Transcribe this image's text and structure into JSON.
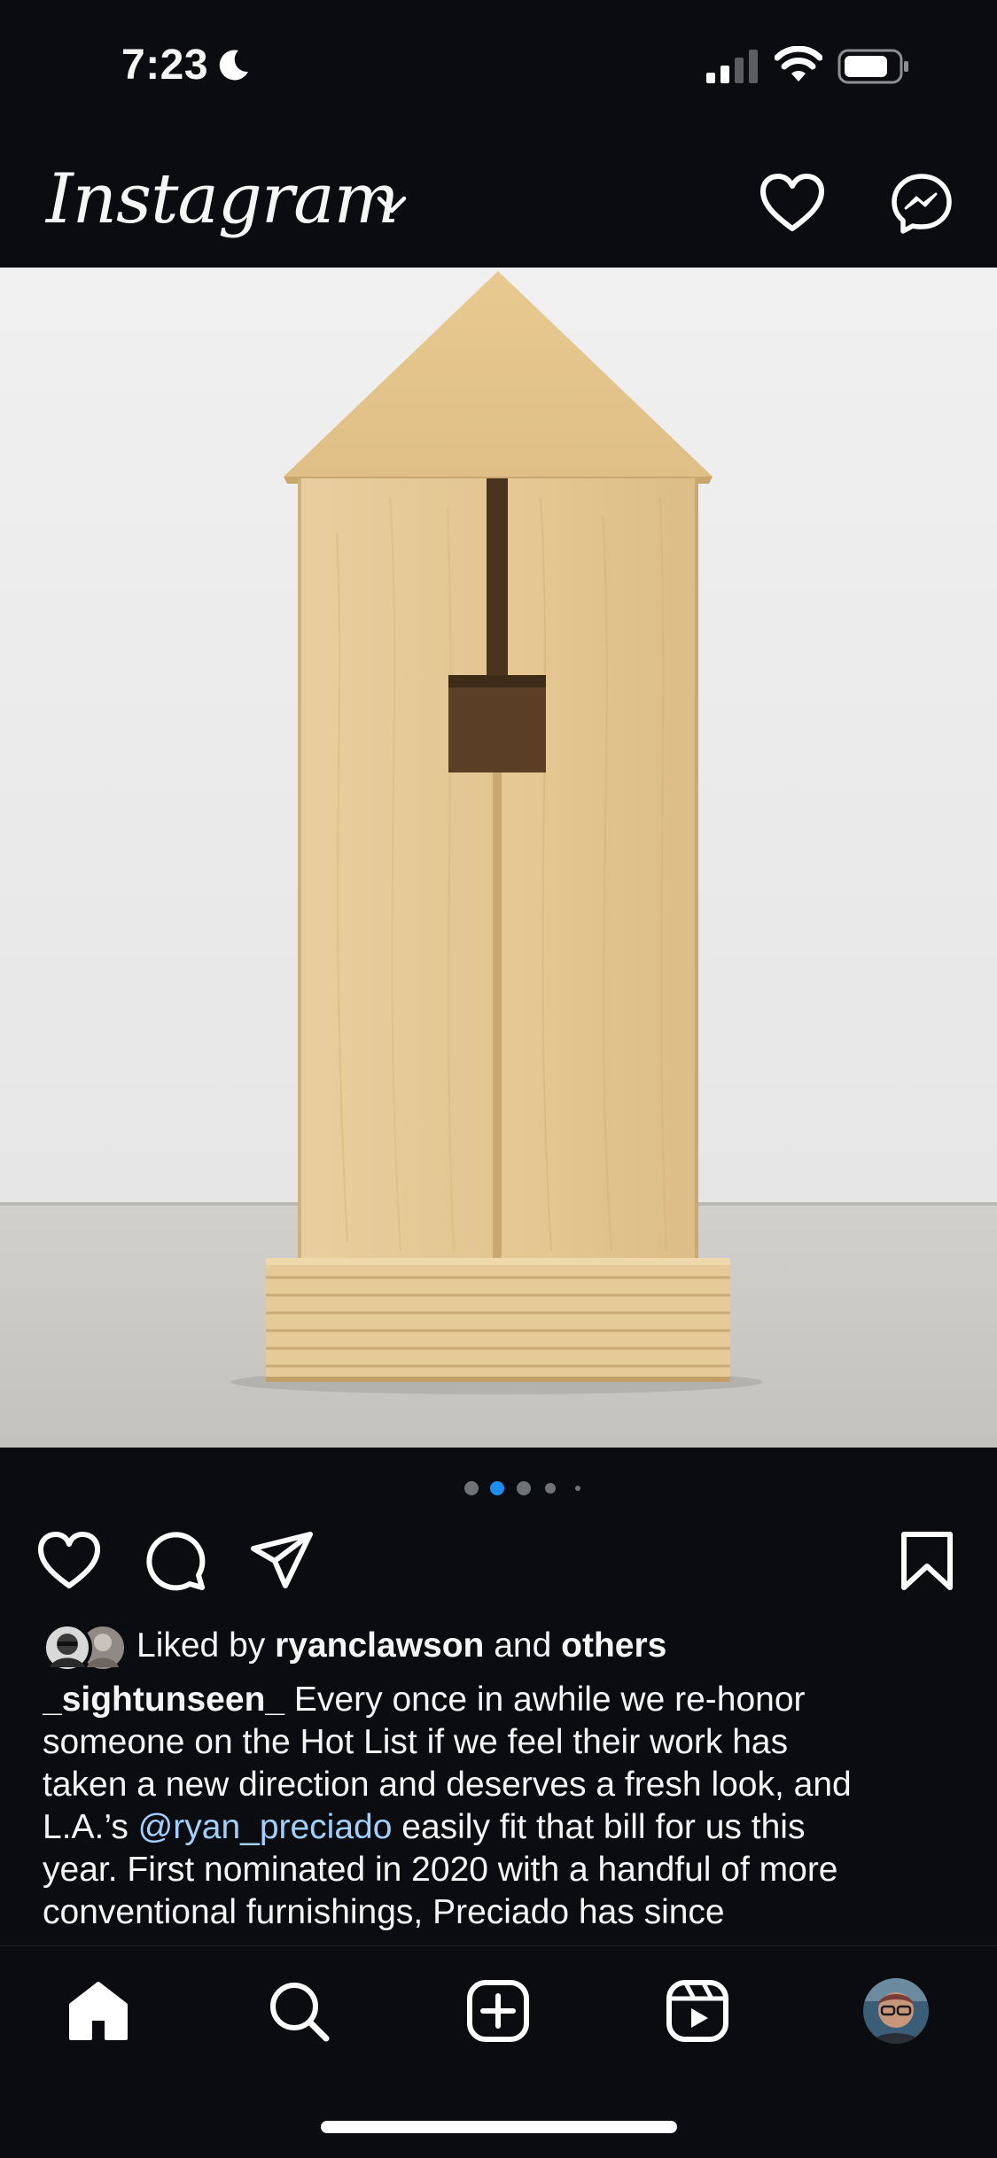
{
  "status_bar": {
    "time": "7:23"
  },
  "top_nav": {
    "logo": "Instagram"
  },
  "carousel": {
    "count": 5,
    "active_index": 1
  },
  "likes": {
    "prefix": "Liked by ",
    "user": "ryanclawson",
    "middle": " and ",
    "others": "others"
  },
  "caption": {
    "username": "_sightunseen_",
    "text_line1": " Every once in awhile we re-honor",
    "line2": "someone on the Hot List if we feel their work has",
    "line3": "taken a new direction and deserves a fresh look, and",
    "line4_pre": "L.A.’s ",
    "mention": "@ryan_preciado",
    "line4_post": " easily fit that bill for us this",
    "line5": "year. First nominated in 2020 with a handful of more",
    "line6": "conventional furnishings, Preciado has since"
  },
  "colors": {
    "background": "#0b0c10",
    "accent": "#1b8df5",
    "mention": "#9fd0ff",
    "wall": "#ececec",
    "floor": "#c9c7c2",
    "wood": "#e3c48f"
  },
  "icons": [
    "moon-icon",
    "signal-icon",
    "wifi-icon",
    "battery-icon",
    "chevron-down-icon",
    "heart-icon",
    "messenger-icon",
    "comment-icon",
    "share-icon",
    "bookmark-icon",
    "home-icon",
    "search-icon",
    "create-icon",
    "reels-icon"
  ]
}
